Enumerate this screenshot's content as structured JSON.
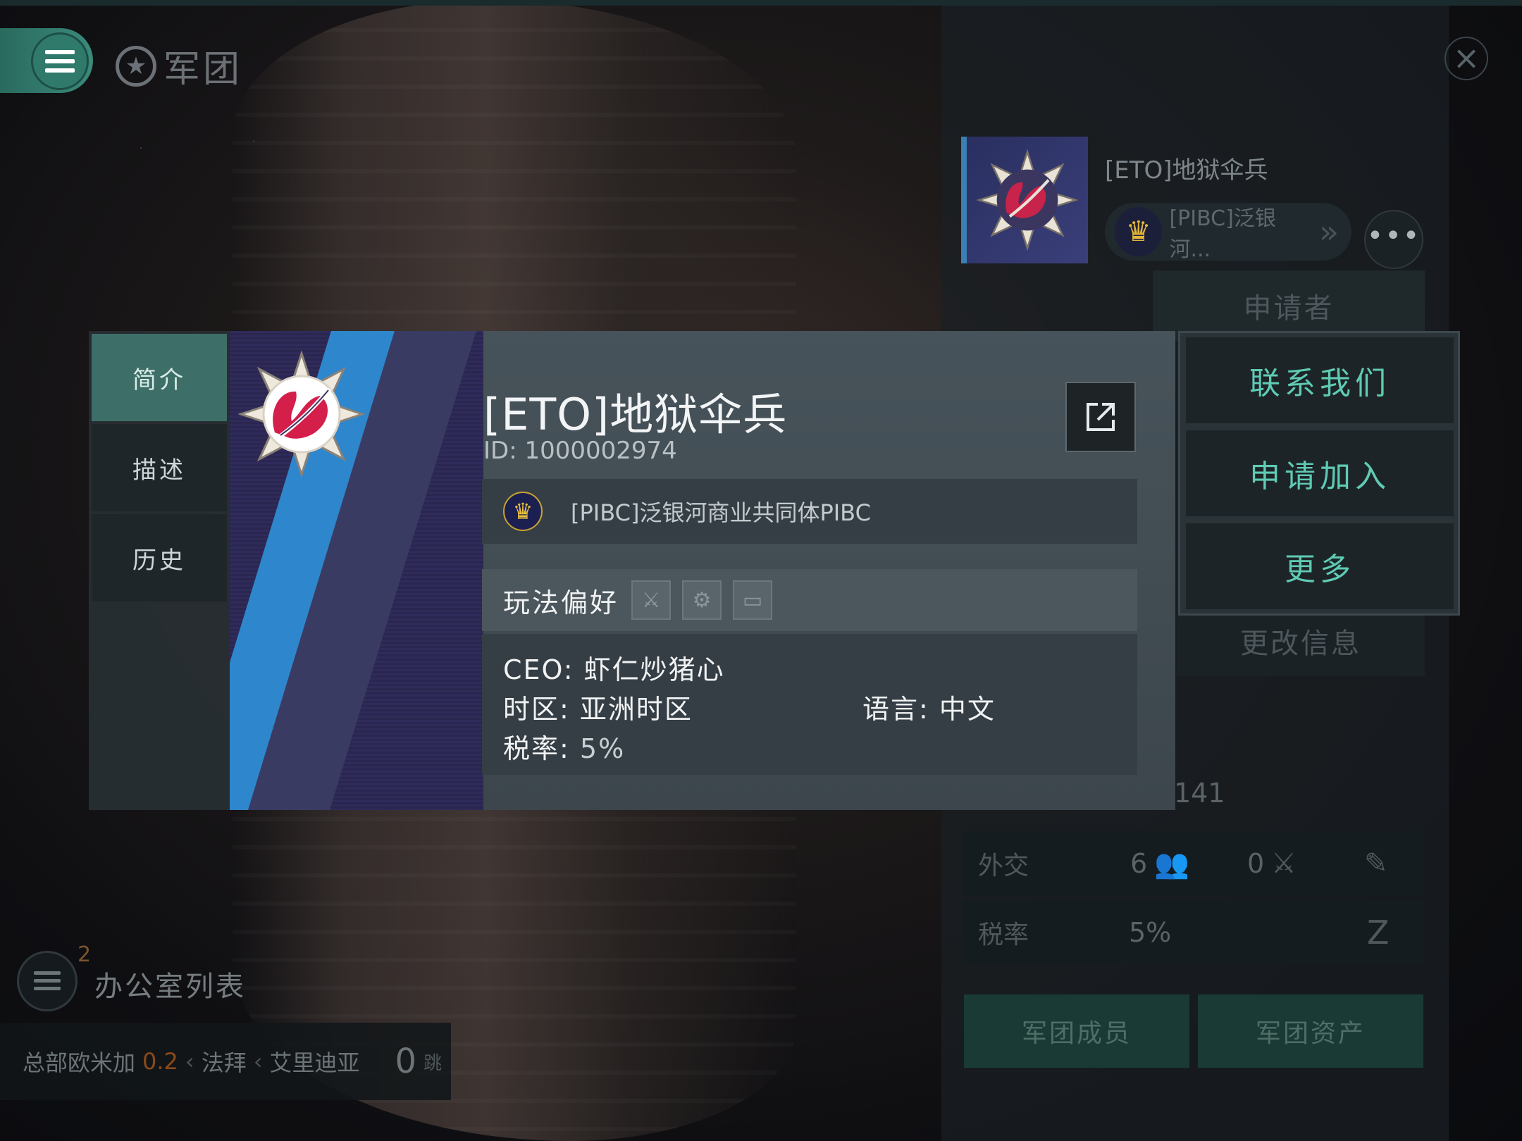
{
  "header": {
    "title": "军团"
  },
  "background_corp": {
    "name": "[ETO]地狱伞兵",
    "alliance_short": "[PIBC]泛银河...",
    "tab_applicants": "申请者",
    "tab_edit_info": "更改信息",
    "partial_value": "141",
    "diplomacy_label": "外交",
    "diplomacy_friendly": "6",
    "diplomacy_hostile": "0",
    "tax_label": "税率",
    "tax_value": "5%",
    "members_button": "军团成员",
    "assets_button": "军团资产"
  },
  "offices": {
    "badge_count": "2",
    "label": "办公室列表"
  },
  "route": {
    "hq_label": "总部欧米加",
    "security": "0.2",
    "system_1": "法拜",
    "system_2": "艾里迪亚",
    "jumps": "0",
    "jumps_label": "跳"
  },
  "modal": {
    "tabs": [
      "简介",
      "描述",
      "历史"
    ],
    "active_tab": 0,
    "corp_name": "[ETO]地狱伞兵",
    "corp_id": "ID: 1000002974",
    "alliance": "[PIBC]泛银河商业共同体PIBC",
    "play_pref_label": "玩法偏好",
    "ceo": "CEO: 虾仁炒猪心",
    "timezone": "时区: 亚洲时区",
    "language": "语言: 中文",
    "tax_label": "税率: ",
    "tax_value": "5%"
  },
  "actions": {
    "contact": "联系我们",
    "apply": "申请加入",
    "more": "更多"
  },
  "colors": {
    "accent_teal": "#5fcbb4",
    "active_tab": "#3e6e68",
    "banner_purple": "#2f2b5a",
    "banner_blue": "#2e86cc",
    "security_orange": "#8a4a1a"
  },
  "icons": [
    "menu-icon",
    "corp-star-icon",
    "close-icon",
    "external-link-icon",
    "crown-icon",
    "pvp-swords-icon",
    "industry-gear-icon",
    "chat-bubble-icon",
    "chevron-right-icon",
    "more-dots-icon",
    "edit-icon",
    "tax-settings-icon"
  ]
}
